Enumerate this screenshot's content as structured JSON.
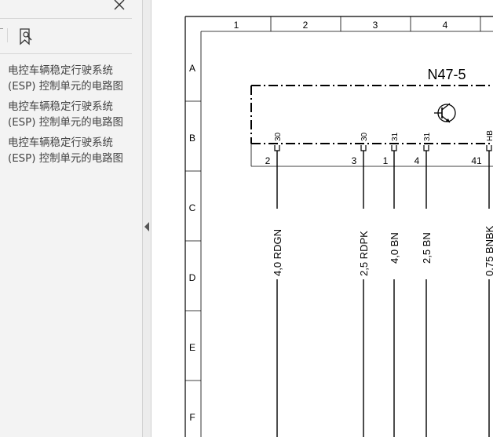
{
  "sidebar": {
    "bookmarks": [
      {
        "line1": "电控车辆稳定行驶系统",
        "line2": "(ESP) 控制单元的电路图"
      },
      {
        "line1": "电控车辆稳定行驶系统",
        "line2": "(ESP) 控制单元的电路图"
      },
      {
        "line1": "电控车辆稳定行驶系统",
        "line2": "(ESP) 控制单元的电路图"
      }
    ]
  },
  "diagram": {
    "component_label": "N47-5",
    "column_numbers": [
      "1",
      "2",
      "3",
      "4"
    ],
    "row_letters": [
      "A",
      "B",
      "C",
      "D",
      "E",
      "F"
    ],
    "pins": [
      {
        "terminal": "30",
        "pin_number": "2",
        "wire": "4,0 RDGN"
      },
      {
        "terminal": "30",
        "pin_number": "3",
        "wire": "2,5 RDPK"
      },
      {
        "terminal": "31",
        "pin_number": "1",
        "wire": "4,0 BN"
      },
      {
        "terminal": "31",
        "pin_number": "4",
        "wire": "2,5 BN"
      },
      {
        "terminal": "HB",
        "pin_number": "41",
        "wire": "0.75 BNBK"
      }
    ]
  }
}
